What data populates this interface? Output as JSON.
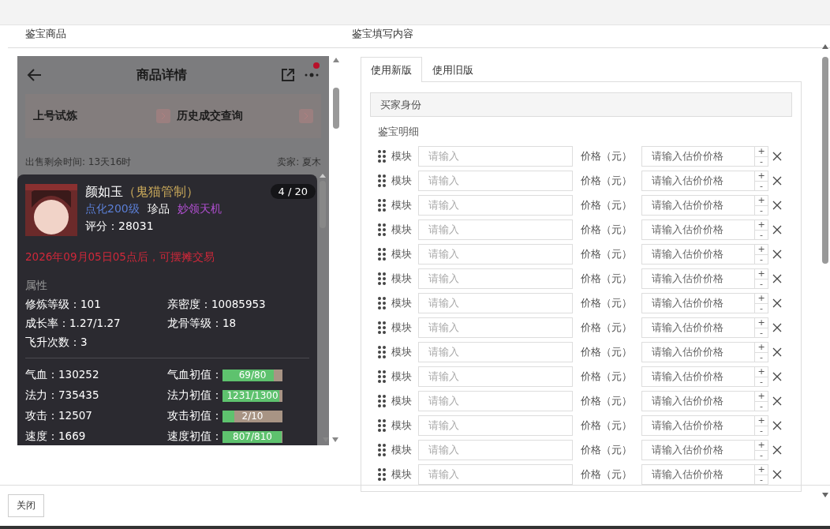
{
  "left_panel": {
    "heading": "鉴宝商品",
    "phone": {
      "title": "商品详情",
      "shortcuts": [
        {
          "label": "上号试炼"
        },
        {
          "label": "历史成交查询"
        }
      ],
      "sale_time": "出售剩余时间: 13天16时",
      "seller": "卖家: 夏木",
      "card": {
        "name": "颜如玉",
        "tag": "（鬼猫管制）",
        "pager": "4 / 20",
        "badges": [
          {
            "text": "点化200级",
            "color": "#5b7fd6"
          },
          {
            "text": "珍品",
            "color": "#ffffff"
          },
          {
            "text": "妙领天机",
            "color": "#b04fd0"
          }
        ],
        "score": "评分：28031",
        "notice": "2026年09月05日05点后，可摆摊交易",
        "section": "属性",
        "attributes": [
          [
            "修炼等级：101",
            "亲密度：10085953"
          ],
          [
            "成长率：1.27/1.27",
            "龙骨等级：18"
          ],
          [
            "飞升次数：3"
          ]
        ],
        "stats": [
          {
            "label": "气血：130252",
            "init_label": "气血初值：",
            "reading": "69/80",
            "level": 0.86
          },
          {
            "label": "法力：735435",
            "init_label": "法力初值：",
            "reading": "1231/1300",
            "level": 0.95
          },
          {
            "label": "攻击：12507",
            "init_label": "攻击初值：",
            "reading": "2/10",
            "level": 0.2
          },
          {
            "label": "速度：1669",
            "init_label": "速度初值：",
            "reading": "807/810",
            "level": 0.99
          }
        ]
      }
    }
  },
  "right_panel": {
    "heading": "鉴宝填写内容",
    "tabs": [
      {
        "label": "使用新版",
        "selected": true
      },
      {
        "label": "使用旧版",
        "selected": false
      }
    ],
    "section": "买家身份",
    "detail_label": "鉴宝明细",
    "rows": [
      {
        "label": "模块",
        "placeholder": "请输入",
        "price_label": "价格（元）",
        "price_placeholder": "请输入估价价格",
        "plus": "+",
        "minus": "-"
      },
      {
        "label": "模块",
        "placeholder": "请输入",
        "price_label": "价格（元）",
        "price_placeholder": "请输入估价价格",
        "plus": "+",
        "minus": "-"
      },
      {
        "label": "模块",
        "placeholder": "请输入",
        "price_label": "价格（元）",
        "price_placeholder": "请输入估价价格",
        "plus": "+",
        "minus": "-"
      },
      {
        "label": "模块",
        "placeholder": "请输入",
        "price_label": "价格（元）",
        "price_placeholder": "请输入估价价格",
        "plus": "+",
        "minus": "-"
      },
      {
        "label": "模块",
        "placeholder": "请输入",
        "price_label": "价格（元）",
        "price_placeholder": "请输入估价价格",
        "plus": "+",
        "minus": "-"
      },
      {
        "label": "模块",
        "placeholder": "请输入",
        "price_label": "价格（元）",
        "price_placeholder": "请输入估价价格",
        "plus": "+",
        "minus": "-"
      },
      {
        "label": "模块",
        "placeholder": "请输入",
        "price_label": "价格（元）",
        "price_placeholder": "请输入估价价格",
        "plus": "+",
        "minus": "-"
      },
      {
        "label": "模块",
        "placeholder": "请输入",
        "price_label": "价格（元）",
        "price_placeholder": "请输入估价价格",
        "plus": "+",
        "minus": "-"
      },
      {
        "label": "模块",
        "placeholder": "请输入",
        "price_label": "价格（元）",
        "price_placeholder": "请输入估价价格",
        "plus": "+",
        "minus": "-"
      },
      {
        "label": "模块",
        "placeholder": "请输入",
        "price_label": "价格（元）",
        "price_placeholder": "请输入估价价格",
        "plus": "+",
        "minus": "-"
      },
      {
        "label": "模块",
        "placeholder": "请输入",
        "price_label": "价格（元）",
        "price_placeholder": "请输入估价价格",
        "plus": "+",
        "minus": "-"
      },
      {
        "label": "模块",
        "placeholder": "请输入",
        "price_label": "价格（元）",
        "price_placeholder": "请输入估价价格",
        "plus": "+",
        "minus": "-"
      },
      {
        "label": "模块",
        "placeholder": "请输入",
        "price_label": "价格（元）",
        "price_placeholder": "请输入估价价格",
        "plus": "+",
        "minus": "-"
      },
      {
        "label": "模块",
        "placeholder": "请输入",
        "price_label": "价格（元）",
        "price_placeholder": "请输入估价价格",
        "plus": "+",
        "minus": "-"
      }
    ]
  },
  "footer": {
    "close_button": "关闭"
  }
}
